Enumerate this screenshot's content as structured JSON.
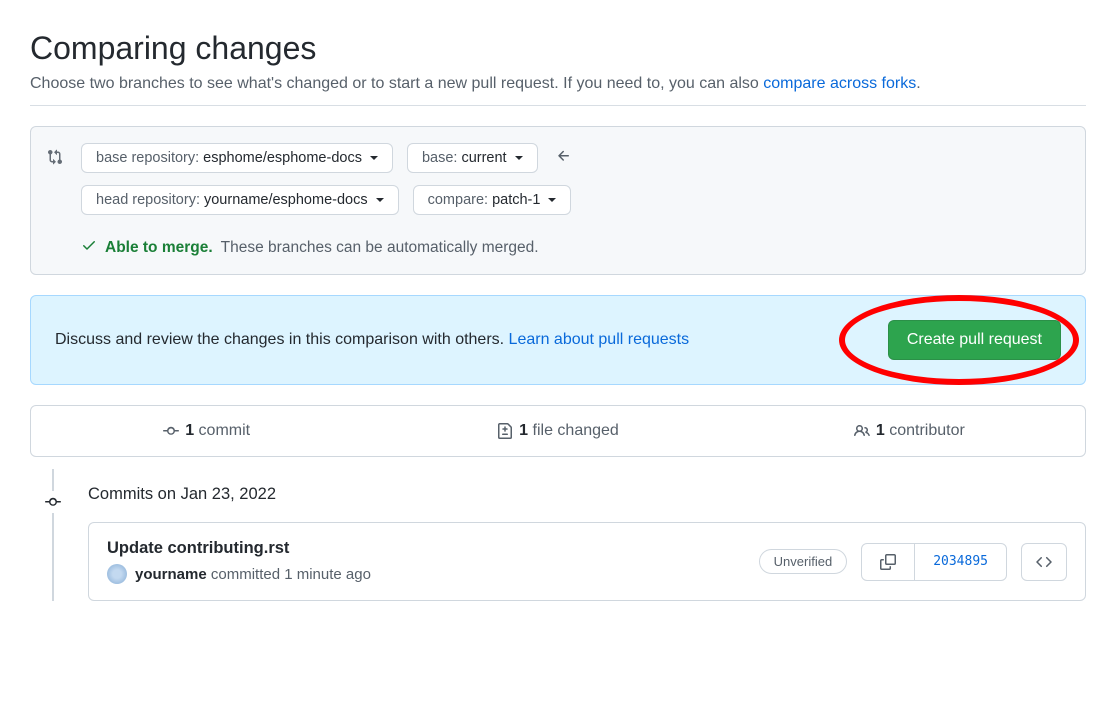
{
  "header": {
    "title": "Comparing changes",
    "subtitle_prefix": "Choose two branches to see what's changed or to start a new pull request. If you need to, you can also ",
    "compare_forks_link": "compare across forks",
    "subtitle_suffix": "."
  },
  "range": {
    "base_repo_label": "base repository: ",
    "base_repo_value": "esphome/esphome-docs",
    "base_label": "base: ",
    "base_value": "current",
    "head_repo_label": "head repository: ",
    "head_repo_value": "yourname/esphome-docs",
    "compare_label": "compare: ",
    "compare_value": "patch-1"
  },
  "merge": {
    "status": "Able to merge.",
    "description": "These branches can be automatically merged."
  },
  "pr_banner": {
    "text_prefix": "Discuss and review the changes in this comparison with others. ",
    "learn_link": "Learn about pull requests",
    "button": "Create pull request"
  },
  "stats": {
    "commits_count": "1",
    "commits_label": " commit",
    "files_count": "1",
    "files_label": " file changed",
    "contributors_count": "1",
    "contributors_label": " contributor"
  },
  "timeline": {
    "date_label": "Commits on Jan 23, 2022",
    "commit": {
      "title": "Update contributing.rst",
      "username": "yourname",
      "action": " committed 1 minute ago",
      "verification": "Unverified",
      "sha": "2034895"
    }
  }
}
